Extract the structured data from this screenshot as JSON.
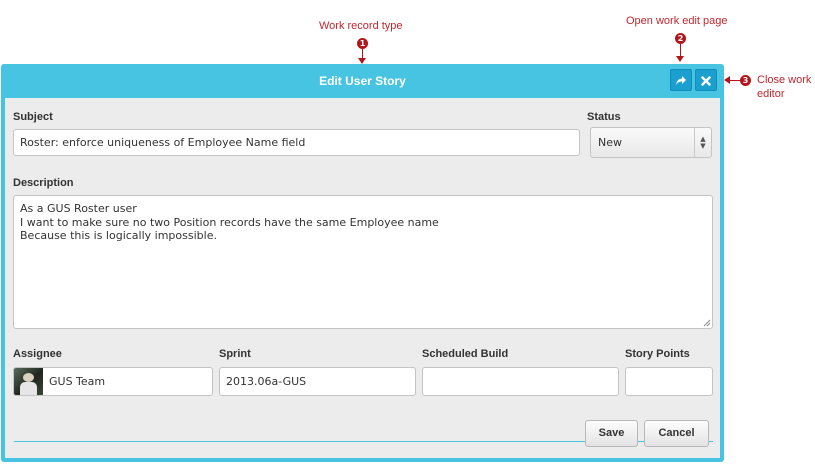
{
  "callouts": [
    {
      "number": "1",
      "text": "Work record type"
    },
    {
      "number": "2",
      "text": "Open work edit page"
    },
    {
      "number": "3",
      "text_line1": "Close work",
      "text_line2": "editor"
    }
  ],
  "modal": {
    "title": "Edit User Story",
    "open_icon": "share-arrow-icon",
    "close_icon": "close-icon",
    "accent_color": "#47c4e1"
  },
  "form": {
    "subject": {
      "label": "Subject",
      "value": "Roster: enforce uniqueness of Employee Name field"
    },
    "status": {
      "label": "Status",
      "value": "New"
    },
    "description": {
      "label": "Description",
      "value": "As a GUS Roster user\nI want to make sure no two Position records have the same Employee name\nBecause this is logically impossible."
    },
    "assignee": {
      "label": "Assignee",
      "value": "GUS Team"
    },
    "sprint": {
      "label": "Sprint",
      "value": "2013.06a-GUS"
    },
    "scheduled_build": {
      "label": "Scheduled Build",
      "value": ""
    },
    "story_points": {
      "label": "Story Points",
      "value": ""
    }
  },
  "buttons": {
    "save": "Save",
    "cancel": "Cancel"
  }
}
